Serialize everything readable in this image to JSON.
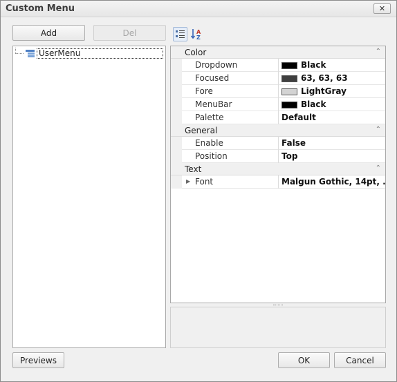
{
  "window": {
    "title": "Custom Menu",
    "close_symbol": "✕"
  },
  "toolbar": {
    "add_label": "Add",
    "del_label": "Del"
  },
  "tree": {
    "root_label": "UserMenu"
  },
  "grid_toolbar": {
    "categorized_icon": "categorized-icon",
    "alphabetical_icon": "sort-alphabetical-icon"
  },
  "property_grid": {
    "categories": [
      {
        "name": "Color",
        "properties": [
          {
            "name": "Dropdown",
            "value": "Black",
            "swatch": "#000000"
          },
          {
            "name": "Focused",
            "value": "63, 63, 63",
            "swatch": "#3f3f3f"
          },
          {
            "name": "Fore",
            "value": "LightGray",
            "swatch": "#d3d3d3"
          },
          {
            "name": "MenuBar",
            "value": "Black",
            "swatch": "#000000"
          },
          {
            "name": "Palette",
            "value": "Default"
          }
        ]
      },
      {
        "name": "General",
        "properties": [
          {
            "name": "Enable",
            "value": "False"
          },
          {
            "name": "Position",
            "value": "Top"
          }
        ]
      },
      {
        "name": "Text",
        "properties": [
          {
            "name": "Font",
            "value": "Malgun Gothic, 14pt, ...",
            "expandable": true
          }
        ]
      }
    ]
  },
  "footer": {
    "previews_label": "Previews",
    "ok_label": "OK",
    "cancel_label": "Cancel"
  }
}
